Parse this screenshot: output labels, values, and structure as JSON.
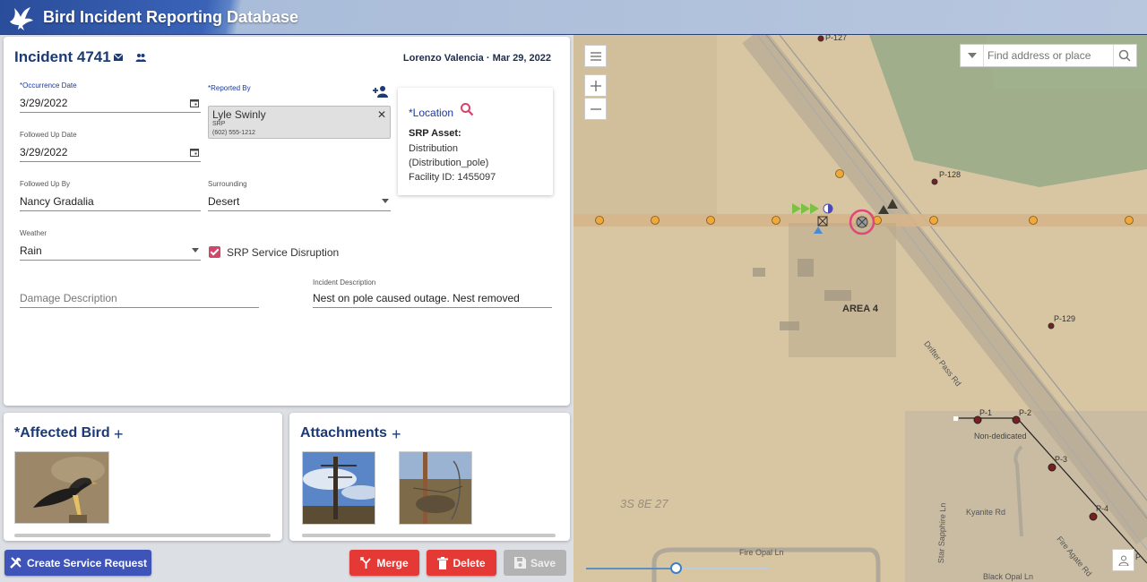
{
  "app": {
    "title": "Bird Incident Reporting Database"
  },
  "incident": {
    "title": "Incident 4741",
    "user": "Lorenzo Valencia",
    "date": "Mar 29, 2022",
    "fields": {
      "occurrence_date": {
        "label": "*Occurrence Date",
        "value": "3/29/2022"
      },
      "followed_up_date": {
        "label": "Followed Up Date",
        "value": "3/29/2022"
      },
      "followed_up_by": {
        "label": "Followed Up By",
        "value": "Nancy Gradalia"
      },
      "weather": {
        "label": "Weather",
        "value": "Rain"
      },
      "reported_by": {
        "label": "*Reported By",
        "name": "Lyle Swinly",
        "org": "SRP",
        "phone": "(602) 555-1212"
      },
      "surrounding": {
        "label": "Surrounding",
        "value": "Desert"
      },
      "srp_service_disruption": {
        "label": "SRP Service Disruption",
        "checked": true
      },
      "damage_description": {
        "placeholder": "Damage Description"
      },
      "incident_description": {
        "label": "Incident Description",
        "value": "Nest on pole caused outage.  Nest removed"
      }
    },
    "location": {
      "label": "*Location",
      "asset_title": "SRP Asset:",
      "line1": "Distribution",
      "line2": "(Distribution_pole)",
      "line3": "Facility ID: 1455097"
    }
  },
  "sections": {
    "affected_bird": "*Affected Bird",
    "attachments": "Attachments"
  },
  "buttons": {
    "create_service_request": "Create Service Request",
    "merge": "Merge",
    "delete": "Delete",
    "save": "Save"
  },
  "map": {
    "search_placeholder": "Find address or place",
    "labels": {
      "p127": "P-127",
      "p128": "P-128",
      "p129": "P-129",
      "area4": "AREA 4",
      "drifter_pass": "Drifter Pass Rd",
      "p1": "P-1",
      "p2": "P-2",
      "p3": "P-3",
      "p4": "P-4",
      "non_dedicated": "Non-dedicated",
      "kyanite": "Kyanite Rd",
      "star_sapphire": "Star Sapphire Ln",
      "fire_opal": "Fire Opal Ln",
      "black_opal": "Black Opal Ln",
      "fire_agate": "Fire Agate Rd",
      "section": "3S 8E 27",
      "p_edge": "P"
    }
  },
  "colors": {
    "accent": "#1c3a73",
    "danger": "#e53935",
    "primary": "#3e54b8",
    "pink": "#d3456b",
    "pole": "#f0a83a"
  }
}
